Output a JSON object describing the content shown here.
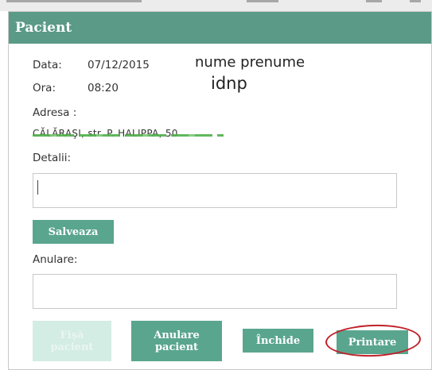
{
  "dialog": {
    "title": "Pacient"
  },
  "fields": {
    "date_label": "Data:",
    "date_value": "07/12/2015",
    "time_label": "Ora:",
    "time_value": "08:20",
    "name_overlay": "nume prenume",
    "idnp_overlay": "idnp",
    "address_label": "Adresa :",
    "address_value": "CĂLĂRAŞI, str. P. HALIPPA, 50",
    "details_label": "Detalii:",
    "cancel_label": "Anulare:"
  },
  "buttons": {
    "save": "Salveaza",
    "patient_file": "Fişă pacient",
    "cancel_patient": "Anulare pacient",
    "close": "Închide",
    "print": "Printare"
  },
  "colors": {
    "header": "#5a9a87",
    "button": "#5aa58e",
    "button_disabled": "#d3ece4",
    "highlight": "#c0222a",
    "address_strike": "#4fb04a"
  }
}
